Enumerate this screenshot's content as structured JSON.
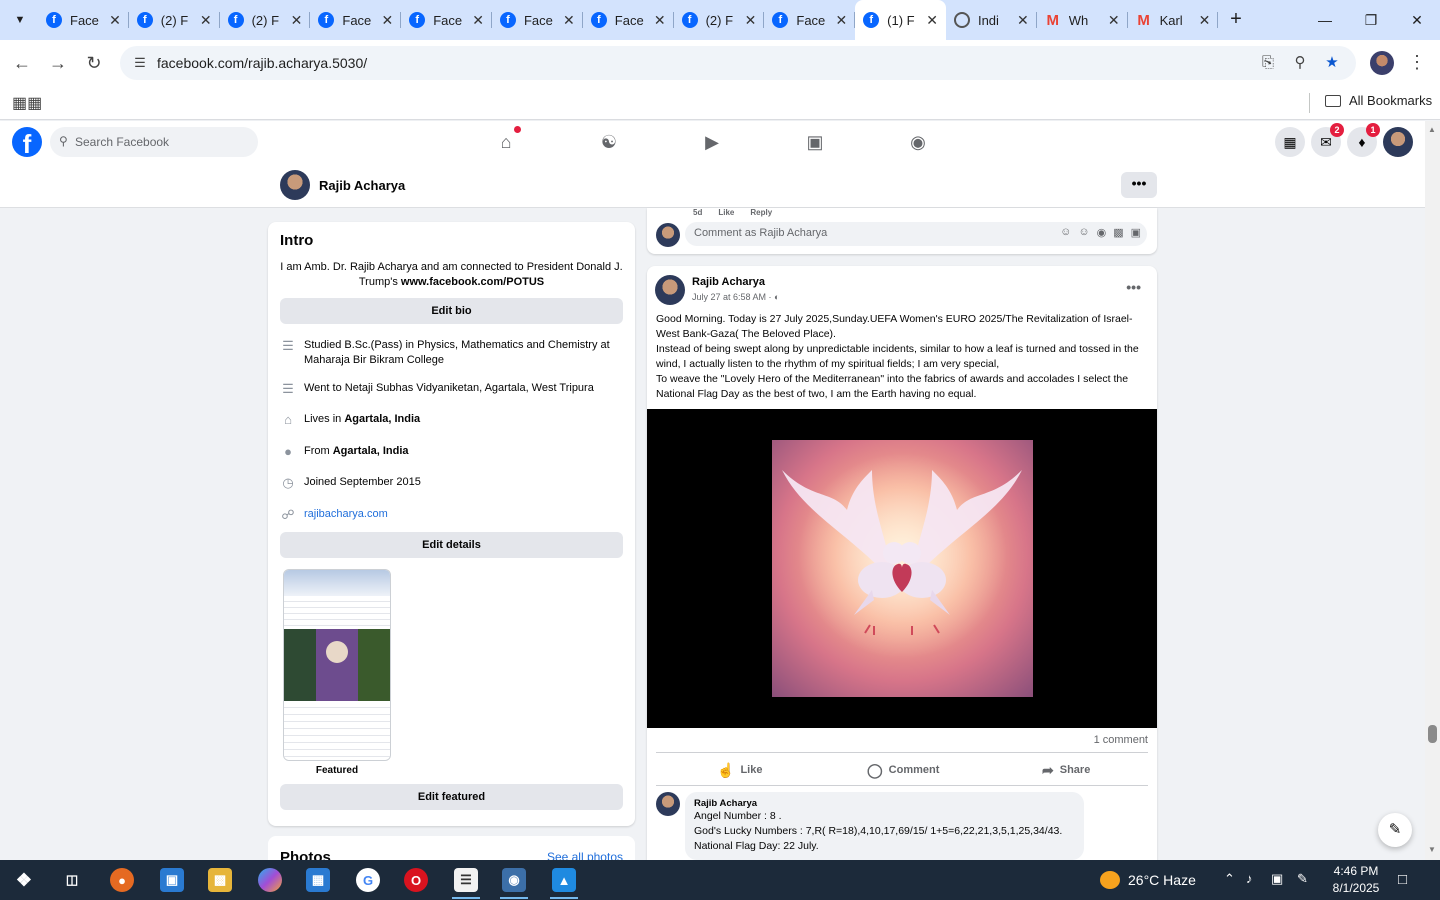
{
  "browser": {
    "tabs": [
      {
        "favicon": "facebook",
        "title": "Face"
      },
      {
        "favicon": "facebook",
        "title": "(2) F"
      },
      {
        "favicon": "facebook",
        "title": "(2) F"
      },
      {
        "favicon": "facebook",
        "title": "Face"
      },
      {
        "favicon": "facebook",
        "title": "Face"
      },
      {
        "favicon": "facebook",
        "title": "Face"
      },
      {
        "favicon": "facebook",
        "title": "Face"
      },
      {
        "favicon": "facebook",
        "title": "(2) F"
      },
      {
        "favicon": "facebook",
        "title": "Face"
      },
      {
        "favicon": "facebook",
        "title": "(1) F",
        "active": true
      },
      {
        "favicon": "globe",
        "title": "Indi"
      },
      {
        "favicon": "gmail",
        "title": "Wh"
      },
      {
        "favicon": "gmail",
        "title": "Karl"
      }
    ],
    "url": "facebook.com/rajib.acharya.5030/",
    "bookmarks_label": "All Bookmarks"
  },
  "fb": {
    "search_placeholder": "Search Facebook",
    "messenger_badge": "2",
    "notifications_badge": "1"
  },
  "profile": {
    "name": "Rajib Acharya",
    "more_label": "•••"
  },
  "intro": {
    "title": "Intro",
    "bio_text": "I am Amb. Dr. Rajib Acharya and am connected to President Donald J. Trump's ",
    "bio_link": "www.facebook.com/POTUS",
    "edit_bio": "Edit bio",
    "studied": "Studied B.Sc.(Pass) in Physics, Mathematics and Chemistry at Maharaja Bir Bikram College",
    "went_to": "Went to Netaji Subhas Vidyaniketan, Agartala, West Tripura",
    "lives_prefix": "Lives in ",
    "lives_place": "Agartala, India",
    "from_prefix": "From ",
    "from_place": "Agartala, India",
    "joined": "Joined September 2015",
    "website": "rajibacharya.com",
    "edit_details": "Edit details",
    "featured_label": "Featured",
    "edit_featured": "Edit featured"
  },
  "photos": {
    "title": "Photos",
    "see_all": "See all photos"
  },
  "prev_post": {
    "time": "5d",
    "like": "Like",
    "reply": "Reply",
    "comment_placeholder": "Comment as Rajib Acharya"
  },
  "post": {
    "author": "Rajib Acharya",
    "meta": "July 27 at 6:58 AM · ",
    "privacy_icon": "globe-icon",
    "text_lines": [
      "Good Morning. Today is 27 July 2025,Sunday.UEFA Women's EURO 2025/The Revitalization of Israel-West Bank-Gaza( The Beloved Place).",
      "Instead of being swept along by unpredictable incidents, similar to how a leaf is turned and tossed in the wind, I actually listen to the rhythm of my spiritual fields; I am very special,",
      "To weave the \"Lovely Hero of the Mediterranean\" into the fabrics of awards and accolades I select the National  Flag Day as the best of two, I am the Earth having no equal."
    ],
    "comments_count": "1 comment",
    "like_label": "Like",
    "comment_label": "Comment",
    "share_label": "Share",
    "comment": {
      "author": "Rajib Acharya",
      "lines": [
        "Angel Number : 8 .",
        "God's Lucky Numbers : 7,R( R=18),4,10,17,69/15/ 1+5=6,22,21,3,5,1,25,34/43.",
        "National Flag Day: 22 July."
      ]
    }
  },
  "taskbar": {
    "weather": "26°C  Haze",
    "time": "4:46 PM",
    "date": "8/1/2025"
  }
}
